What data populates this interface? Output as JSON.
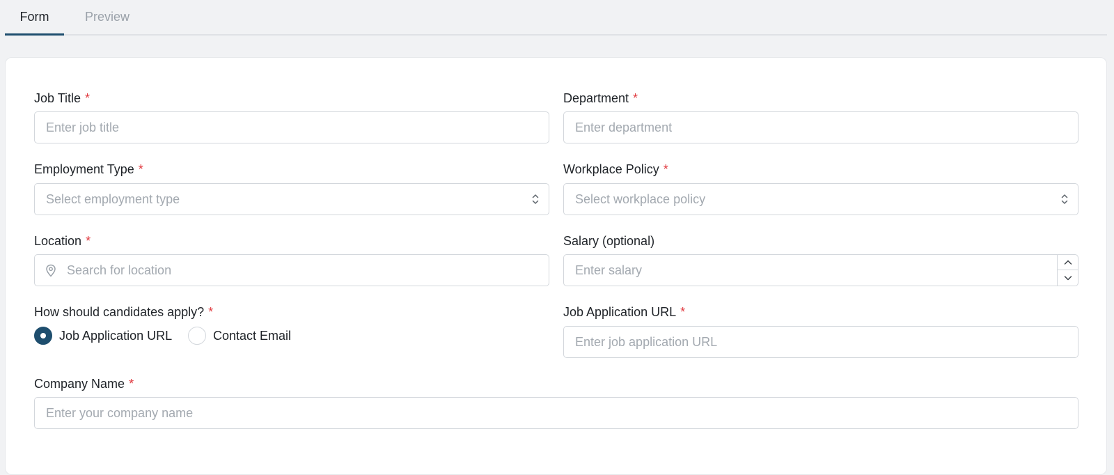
{
  "tabs": [
    {
      "label": "Form",
      "active": true
    },
    {
      "label": "Preview",
      "active": false
    }
  ],
  "form": {
    "required_marker": "*",
    "job_title": {
      "label": "Job Title",
      "placeholder": "Enter job title"
    },
    "department": {
      "label": "Department",
      "placeholder": "Enter department"
    },
    "employment_type": {
      "label": "Employment Type",
      "placeholder": "Select employment type"
    },
    "workplace_policy": {
      "label": "Workplace Policy",
      "placeholder": "Select workplace policy"
    },
    "location": {
      "label": "Location",
      "placeholder": "Search for location"
    },
    "salary": {
      "label": "Salary (optional)",
      "placeholder": "Enter salary"
    },
    "apply_method": {
      "label": "How should candidates apply?",
      "options": [
        {
          "label": "Job Application URL",
          "selected": true
        },
        {
          "label": "Contact Email",
          "selected": false
        }
      ]
    },
    "job_application_url": {
      "label": "Job Application URL",
      "placeholder": "Enter job application URL"
    },
    "company_name": {
      "label": "Company Name",
      "placeholder": "Enter your company name"
    }
  },
  "colors": {
    "accent": "#1e4e6e",
    "required": "#e0383e",
    "placeholder": "#a3a9b0"
  }
}
